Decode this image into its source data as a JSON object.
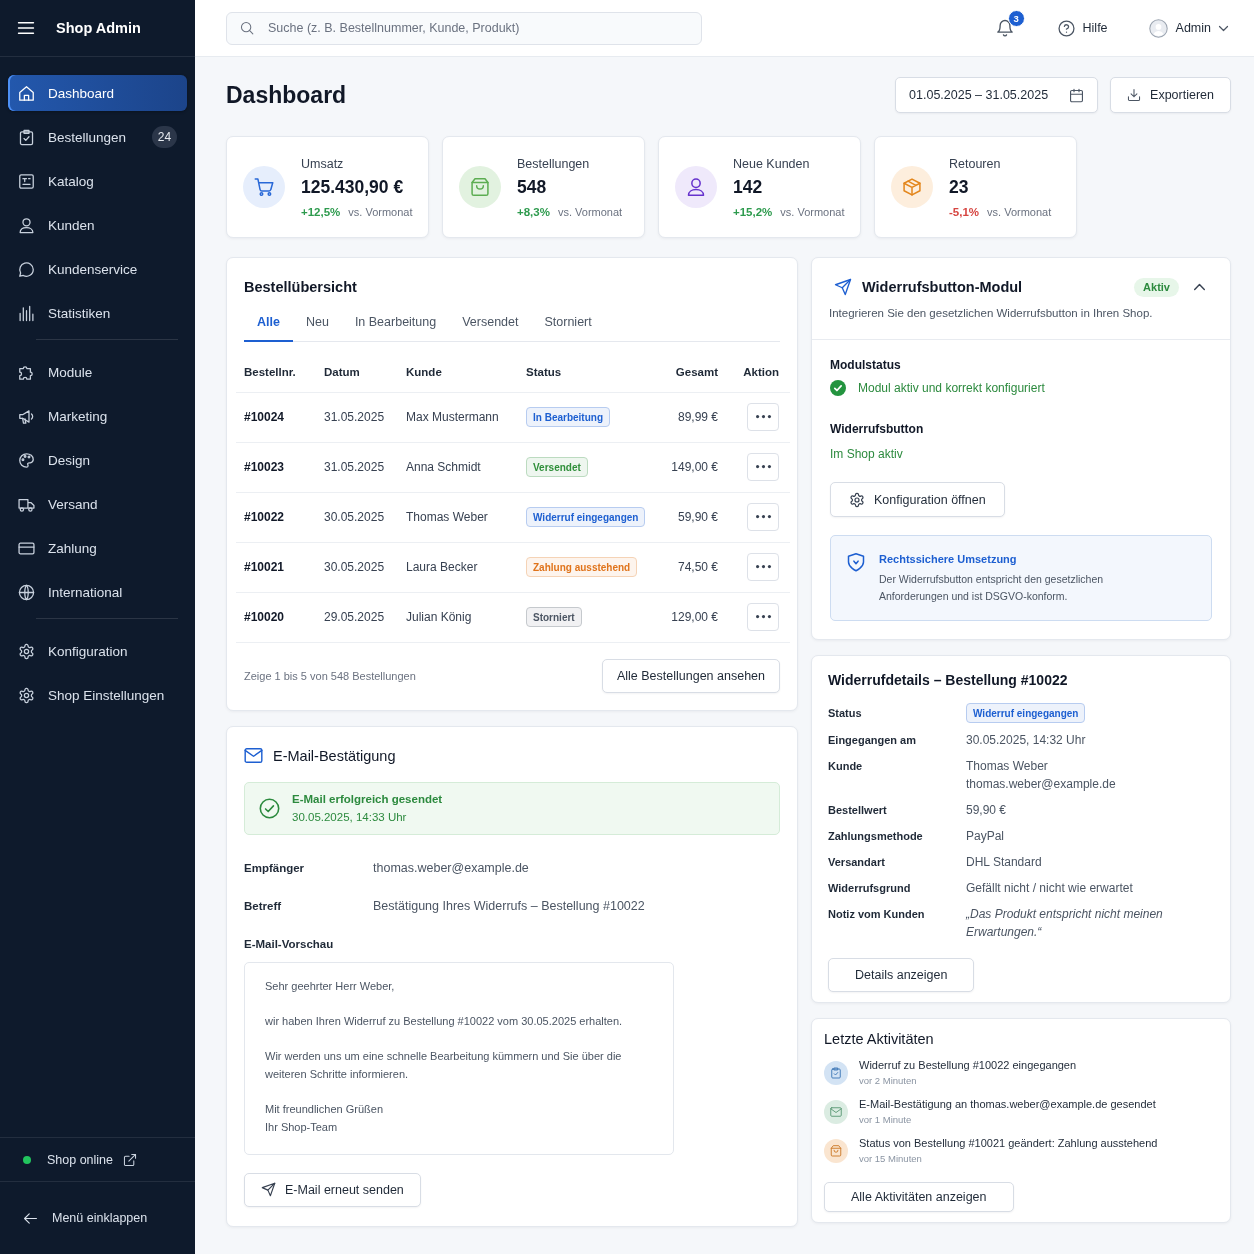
{
  "sidebar": {
    "title": "Shop Admin",
    "sections": [
      {
        "items": [
          {
            "label": "Dashboard",
            "selected": true
          },
          {
            "label": "Bestellungen",
            "selected": false,
            "badge": "24"
          },
          {
            "label": "Katalog",
            "selected": false
          },
          {
            "label": "Kunden",
            "selected": false
          },
          {
            "label": "Kundenservice",
            "selected": false
          },
          {
            "label": "Statistiken",
            "selected": false
          }
        ]
      },
      {
        "items": [
          {
            "label": "Module",
            "selected": false
          },
          {
            "label": "Marketing",
            "selected": false
          },
          {
            "label": "Design",
            "selected": false
          },
          {
            "label": "Versand",
            "selected": false
          },
          {
            "label": "Zahlung",
            "selected": false
          },
          {
            "label": "International",
            "selected": false
          }
        ]
      },
      {
        "items": [
          {
            "label": "Konfiguration",
            "selected": false
          },
          {
            "label": "Shop Einstellungen",
            "selected": false
          }
        ]
      }
    ],
    "status": {
      "label": "Shop online",
      "online": true
    },
    "collapse": "Menü einklappen"
  },
  "topbar": {
    "search": {
      "placeholder": "Suche (z. B. Bestellnummer, Kunde, Produkt)"
    },
    "notifications": "3",
    "help": "Hilfe",
    "user": "Admin"
  },
  "header": {
    "title": "Dashboard",
    "date_range": "01.05.2025 – 31.05.2025",
    "export": "Exportieren"
  },
  "stats": [
    {
      "label": "Umsatz",
      "value": "125.430,90 €",
      "change": {
        "text": "+12,5%",
        "color": "#2e9b4e"
      },
      "compare": "vs. Vormonat",
      "color": "#e6eefc"
    },
    {
      "label": "Bestellungen",
      "value": "548",
      "change": {
        "text": "+8,3%",
        "color": "#2e9b4e"
      },
      "compare": "vs. Vormonat",
      "color": "#e2f2e0"
    },
    {
      "label": "Neue Kunden",
      "value": "142",
      "change": {
        "text": "+15,2%",
        "color": "#2e9b4e"
      },
      "compare": "vs. Vormonat",
      "color": "#efe9fb"
    },
    {
      "label": "Retouren",
      "value": "23",
      "change": {
        "text": "-5,1%",
        "color": "#d64541"
      },
      "compare": "vs. Vormonat",
      "color": "#fdeedd"
    }
  ],
  "orders": {
    "title": "Bestellübersicht",
    "tabs": [
      {
        "label": "Alle",
        "selected": true
      },
      {
        "label": "Neu",
        "selected": false
      },
      {
        "label": "In Bearbeitung",
        "selected": false
      },
      {
        "label": "Versendet",
        "selected": false
      },
      {
        "label": "Storniert",
        "selected": false
      }
    ],
    "columns": [
      "Bestellnr.",
      "Datum",
      "Kunde",
      "Status",
      "Gesamt",
      "Aktion"
    ],
    "rows": [
      {
        "number": "#10024",
        "date": "31.05.2025",
        "customer": "Max Mustermann",
        "status": {
          "label": "In Bearbeitung",
          "color": "#1d5fd1"
        },
        "total": "89,99 €"
      },
      {
        "number": "#10023",
        "date": "31.05.2025",
        "customer": "Anna Schmidt",
        "status": {
          "label": "Versendet",
          "color": "#2f8f3a"
        },
        "total": "149,00 €"
      },
      {
        "number": "#10022",
        "date": "30.05.2025",
        "customer": "Thomas Weber",
        "status": {
          "label": "Widerruf eingegangen",
          "color": "#1d5fd1"
        },
        "total": "59,90 €"
      },
      {
        "number": "#10021",
        "date": "30.05.2025",
        "customer": "Laura Becker",
        "status": {
          "label": "Zahlung ausstehend",
          "color": "#e0741c"
        },
        "total": "74,50 €"
      },
      {
        "number": "#10020",
        "date": "29.05.2025",
        "customer": "Julian König",
        "status": {
          "label": "Storniert",
          "color": "#4b5563"
        },
        "total": "129,00 €"
      }
    ],
    "summary": "Zeige 1 bis 5 von 548 Bestellungen",
    "button": "Alle Bestellungen ansehen"
  },
  "email": {
    "title": "E-Mail-Bestätigung",
    "success": {
      "title": "E-Mail erfolgreich gesendet",
      "time": "30.05.2025, 14:33 Uhr"
    },
    "fields": [
      {
        "label": "Empfänger",
        "value": "thomas.weber@example.de"
      },
      {
        "label": "Betreff",
        "value": "Bestätigung Ihres Widerrufs – Bestellung #10022"
      }
    ],
    "preview_label": "E-Mail-Vorschau",
    "preview": [
      [
        "Sehr geehrter Herr Weber,"
      ],
      [
        "wir haben Ihren Widerruf zu Bestellung #10022 vom 30.05.2025 erhalten."
      ],
      [
        "Wir werden uns um eine schnelle Bearbeitung kümmern und Sie über die weiteren Schritte informieren."
      ],
      [
        "Mit freundlichen Grüßen",
        "Ihr Shop-Team"
      ]
    ],
    "button": "E-Mail erneut senden"
  },
  "module": {
    "title": "Widerrufsbutton-Modul",
    "badge": "Aktiv",
    "expanded": true,
    "description": "Integrieren Sie den gesetzlichen Widerrufsbutton in Ihren Shop.",
    "sections": [
      {
        "kind": "check",
        "label": "Modulstatus",
        "value": "Modul aktiv und korrekt konfiguriert"
      },
      {
        "kind": "text",
        "label": "Widerrufsbutton",
        "value": "Im Shop aktiv"
      }
    ],
    "button": "Konfiguration öffnen",
    "info": {
      "title": "Rechtssichere Umsetzung",
      "text": "Der Widerrufsbutton entspricht den gesetzlichen Anforderungen und ist DSGVO-konform."
    }
  },
  "details": {
    "title": "Widerrufdetails – Bestellung #10022",
    "rows": [
      {
        "kind": "badge",
        "label": "Status",
        "value": "Widerruf eingegangen",
        "color": "#1d5fd1"
      },
      {
        "kind": "text",
        "label": "Eingegangen am",
        "value": "30.05.2025, 14:32 Uhr"
      },
      {
        "kind": "text",
        "label": "Kunde",
        "value": "Thomas Weber",
        "detail": "thomas.weber@example.de"
      },
      {
        "kind": "text",
        "label": "Bestellwert",
        "value": "59,90 €"
      },
      {
        "kind": "text",
        "label": "Zahlungsmethode",
        "value": "PayPal"
      },
      {
        "kind": "text",
        "label": "Versandart",
        "value": "DHL Standard"
      },
      {
        "kind": "text",
        "label": "Widerrufsgrund",
        "value": "Gefällt nicht / nicht wie erwartet"
      },
      {
        "kind": "quote",
        "label": "Notiz vom Kunden",
        "value": "„Das Produkt entspricht nicht meinen Erwartungen.“"
      }
    ],
    "button": "Details anzeigen"
  },
  "activities": {
    "title": "Letzte Aktivitäten",
    "items": [
      {
        "text": "Widerruf zu Bestellung #10022 eingegangen",
        "time": "vor 2 Minuten",
        "color": "#d3e3f4"
      },
      {
        "text": "E-Mail-Bestätigung an thomas.weber@example.de gesendet",
        "time": "vor 1 Minute",
        "color": "#dbece2"
      },
      {
        "text": "Status von Bestellung #10021 geändert: Zahlung ausstehend",
        "time": "vor 15 Minuten",
        "color": "#fae5d0"
      }
    ],
    "button": "Alle Aktivitäten anzeigen"
  }
}
